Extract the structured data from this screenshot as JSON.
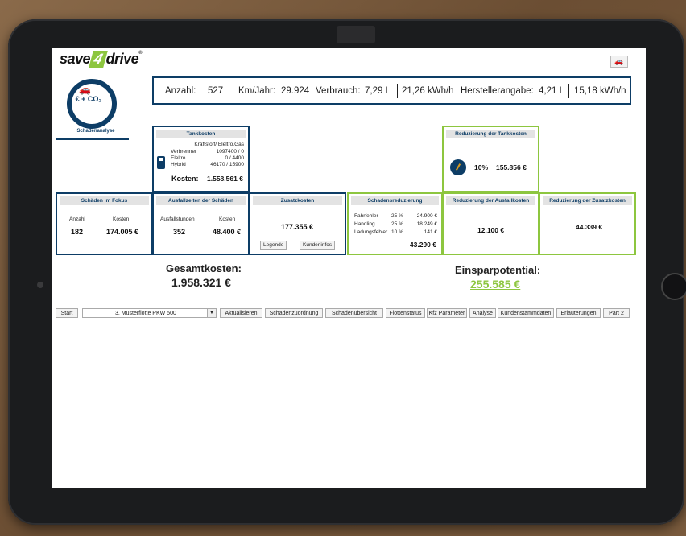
{
  "brand": {
    "logo_pre": "save",
    "logo_num": "4",
    "logo_post": "drive",
    "logo_reg": "®",
    "corner_icon": "car-icon"
  },
  "badge": {
    "text": "€ + CO₂",
    "label": "Schadenanalyse",
    "icon": "car-icon"
  },
  "info": {
    "anzahl_label": "Anzahl:",
    "anzahl": "527",
    "km_label": "Km/Jahr:",
    "km": "29.924",
    "verbrauch_label": "Verbrauch:",
    "verbrauch_l": "7,29 L",
    "verbrauch_kwh": "21,26 kWh/h",
    "hersteller_label": "Herstellerangabe:",
    "hersteller_l": "4,21 L",
    "hersteller_kwh": "15,18 kWh/h"
  },
  "tank": {
    "title": "Tankkosten",
    "header": "Kraftstoff/ Eleltro,Gas",
    "rows": [
      {
        "label": "Verbrenner",
        "value": "1097400 / 0"
      },
      {
        "label": "Eleltro",
        "value": "0 / 4400"
      },
      {
        "label": "Hybrid",
        "value": "46170 / 15900"
      }
    ],
    "kosten_label": "Kosten:",
    "kosten": "1.558.561 €"
  },
  "reduz_tank": {
    "title": "Reduzierung der Tankkosten",
    "pct": "10%",
    "value": "155.856 €"
  },
  "schaeden": {
    "title": "Schäden im Fokus",
    "col1": "Anzahl",
    "col2": "Kosten",
    "v1": "182",
    "v2": "174.005 €"
  },
  "ausfall": {
    "title": "Ausfallzeiten der Schäden",
    "col1": "Ausfallstunden",
    "col2": "Kosten",
    "v1": "352",
    "v2": "48.400 €"
  },
  "zusatz": {
    "title": "Zusatzkosten",
    "value": "177.355 €",
    "btn1": "Legende",
    "btn2": "Kundeninfos"
  },
  "schadensred": {
    "title": "Schadensreduzierung",
    "rows": [
      {
        "label": "Fahrfehler",
        "pct": "25 %",
        "value": "24.900 €"
      },
      {
        "label": "Handling",
        "pct": "25 %",
        "value": "18.249 €"
      },
      {
        "label": "Ladungsfehler",
        "pct": "10 %",
        "value": "141 €"
      }
    ],
    "total": "43.290 €"
  },
  "reduz_ausfall": {
    "title": "Reduzierung der Ausfallkosten",
    "value": "12.100 €"
  },
  "reduz_zusatz": {
    "title": "Reduzierung der Zusatzkosten",
    "value": "44.339 €"
  },
  "totals": {
    "gesamt_label": "Gesamtkosten:",
    "gesamt": "1.958.321 €",
    "einspar_label": "Einsparpotential:",
    "einspar": "255.585 €"
  },
  "nav": {
    "start": "Start",
    "select_value": "3. Musterflotte PKW 500",
    "buttons": [
      "Aktualisieren",
      "Schadenzuordnung",
      "Schadenübersicht",
      "Flottenstatus",
      "Kfz Parameter",
      "Analyse",
      "Kundenstammdaten",
      "Erläuterungen",
      "Part 2"
    ]
  },
  "colors": {
    "navy": "#0d3d66",
    "green": "#8dc63f"
  }
}
